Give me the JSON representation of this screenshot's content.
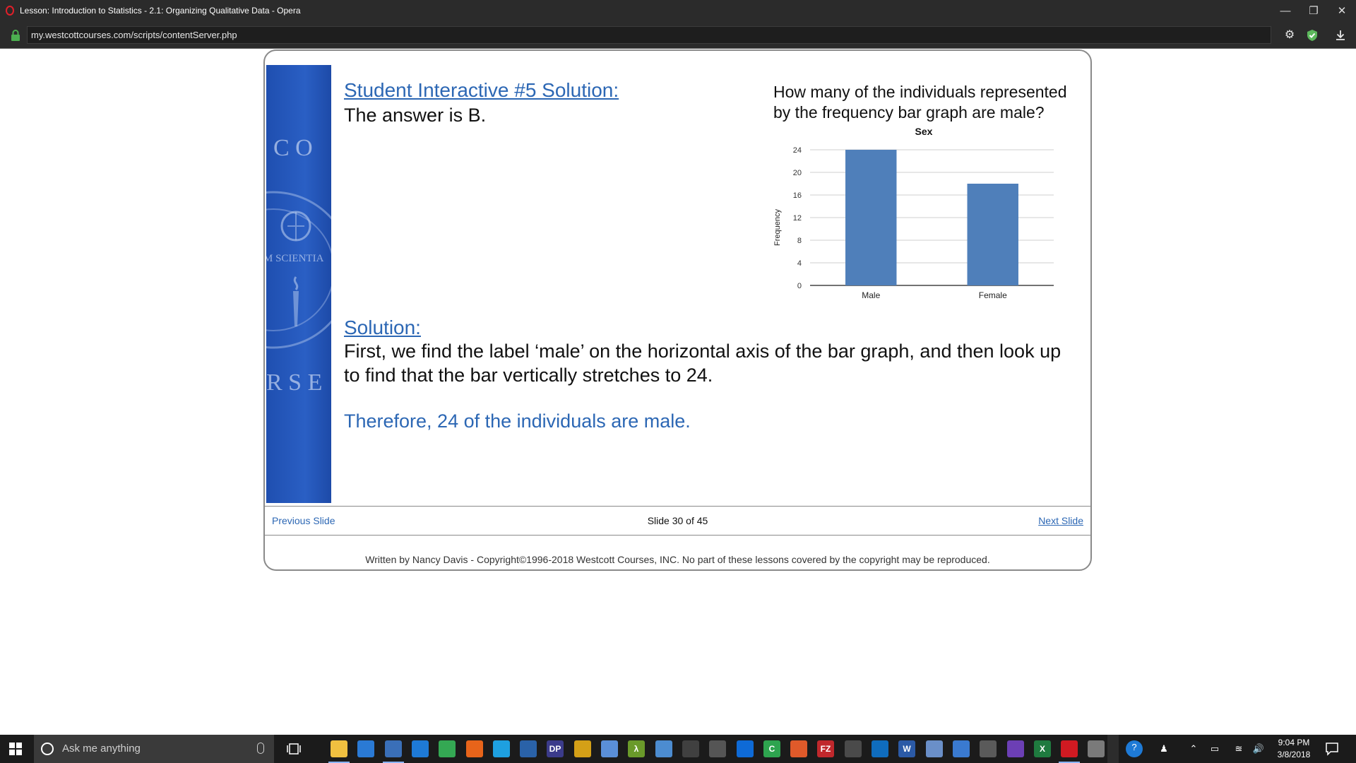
{
  "window": {
    "title": "Lesson: Introduction to Statistics - 2.1: Organizing Qualitative Data - Opera",
    "minimize": "—",
    "restore": "❐",
    "close": "✕"
  },
  "address_bar": {
    "url": "my.westcottcourses.com/scripts/contentServer.php"
  },
  "slide": {
    "interactive_heading": "Student Interactive #5 Solution:",
    "answer": "The answer is B.",
    "question": "How many of the individuals represented by the frequency bar graph are male?",
    "solution_heading": "Solution:",
    "solution_text": "First, we find the label ‘male’ on the horizontal axis of the bar graph, and then look up to find that the bar vertically stretches to 24.",
    "conclusion": "Therefore, 24 of the individuals are male.",
    "banner_text": {
      "top": "C O",
      "middle": "M SCIENTIA",
      "bottom": "R S E"
    }
  },
  "chart_data": {
    "type": "bar",
    "title": "Sex",
    "xlabel": "",
    "ylabel": "Frequency",
    "categories": [
      "Male",
      "Female"
    ],
    "values": [
      24,
      18
    ],
    "ylim": [
      0,
      24
    ],
    "yticks": [
      0,
      4,
      8,
      12,
      16,
      20,
      24
    ],
    "grid": true,
    "bar_color": "#4f7fba"
  },
  "navigation": {
    "previous": "Previous Slide",
    "counter": "Slide 30 of 45",
    "next": "Next Slide"
  },
  "footer": {
    "copyright": "Written by Nancy Davis - Copyright©1996-2018 Westcott Courses, INC. No part of these lessons covered by the copyright may be reproduced."
  },
  "taskbar": {
    "search_placeholder": "Ask me anything",
    "apps": [
      {
        "icon": "file-explorer-icon",
        "color": "#f0c040"
      },
      {
        "icon": "store-icon",
        "color": "#2a7ad5"
      },
      {
        "icon": "visual-studio-installer-icon",
        "color": "#3a6fb8"
      },
      {
        "icon": "edge-icon",
        "color": "#1e7ad6"
      },
      {
        "icon": "chrome-icon",
        "color": "#34a853"
      },
      {
        "icon": "firefox-icon",
        "color": "#e8641a"
      },
      {
        "icon": "internet-explorer-icon",
        "color": "#1ea0e0"
      },
      {
        "icon": "powershell-icon",
        "color": "#2a62a8"
      },
      {
        "icon": "dp-app-icon",
        "color": "#3b3b8a"
      },
      {
        "icon": "star-app-icon",
        "color": "#d4a017"
      },
      {
        "icon": "palette-app-icon",
        "color": "#5a8fd8"
      },
      {
        "icon": "lambda-app-icon",
        "color": "#6a9a2a"
      },
      {
        "icon": "paint-app-icon",
        "color": "#4c8cd0"
      },
      {
        "icon": "bloomberg-app-icon",
        "color": "#404040"
      },
      {
        "icon": "calculator-icon",
        "color": "#555555"
      },
      {
        "icon": "teamviewer-icon",
        "color": "#0e6ad6"
      },
      {
        "icon": "camtasia-icon",
        "color": "#2ea44f"
      },
      {
        "icon": "scrap-app-icon",
        "color": "#e05a2a"
      },
      {
        "icon": "filezilla-icon",
        "color": "#c0282c"
      },
      {
        "icon": "sublime-icon",
        "color": "#4a4a4a"
      },
      {
        "icon": "outlook-icon",
        "color": "#0f6cbd"
      },
      {
        "icon": "word-icon",
        "color": "#2b5aa6"
      },
      {
        "icon": "network-app-icon",
        "color": "#6a8fc8"
      },
      {
        "icon": "remote-desktop-icon",
        "color": "#3a7ad0"
      },
      {
        "icon": "mail-icon",
        "color": "#5a5a5a"
      },
      {
        "icon": "visual-studio-icon",
        "color": "#6c3fb5"
      },
      {
        "icon": "excel-icon",
        "color": "#1f7a3f"
      },
      {
        "icon": "opera-icon",
        "color": "#d01a22"
      },
      {
        "icon": "photos-app-icon",
        "color": "#7a7a7a"
      }
    ],
    "app_labels": {
      "dp": "DP",
      "lambda": "λ",
      "word": "W",
      "excel": "X",
      "camtasia": "C",
      "filezilla": "FZ"
    },
    "time": "9:04 PM",
    "date": "3/8/2018"
  }
}
